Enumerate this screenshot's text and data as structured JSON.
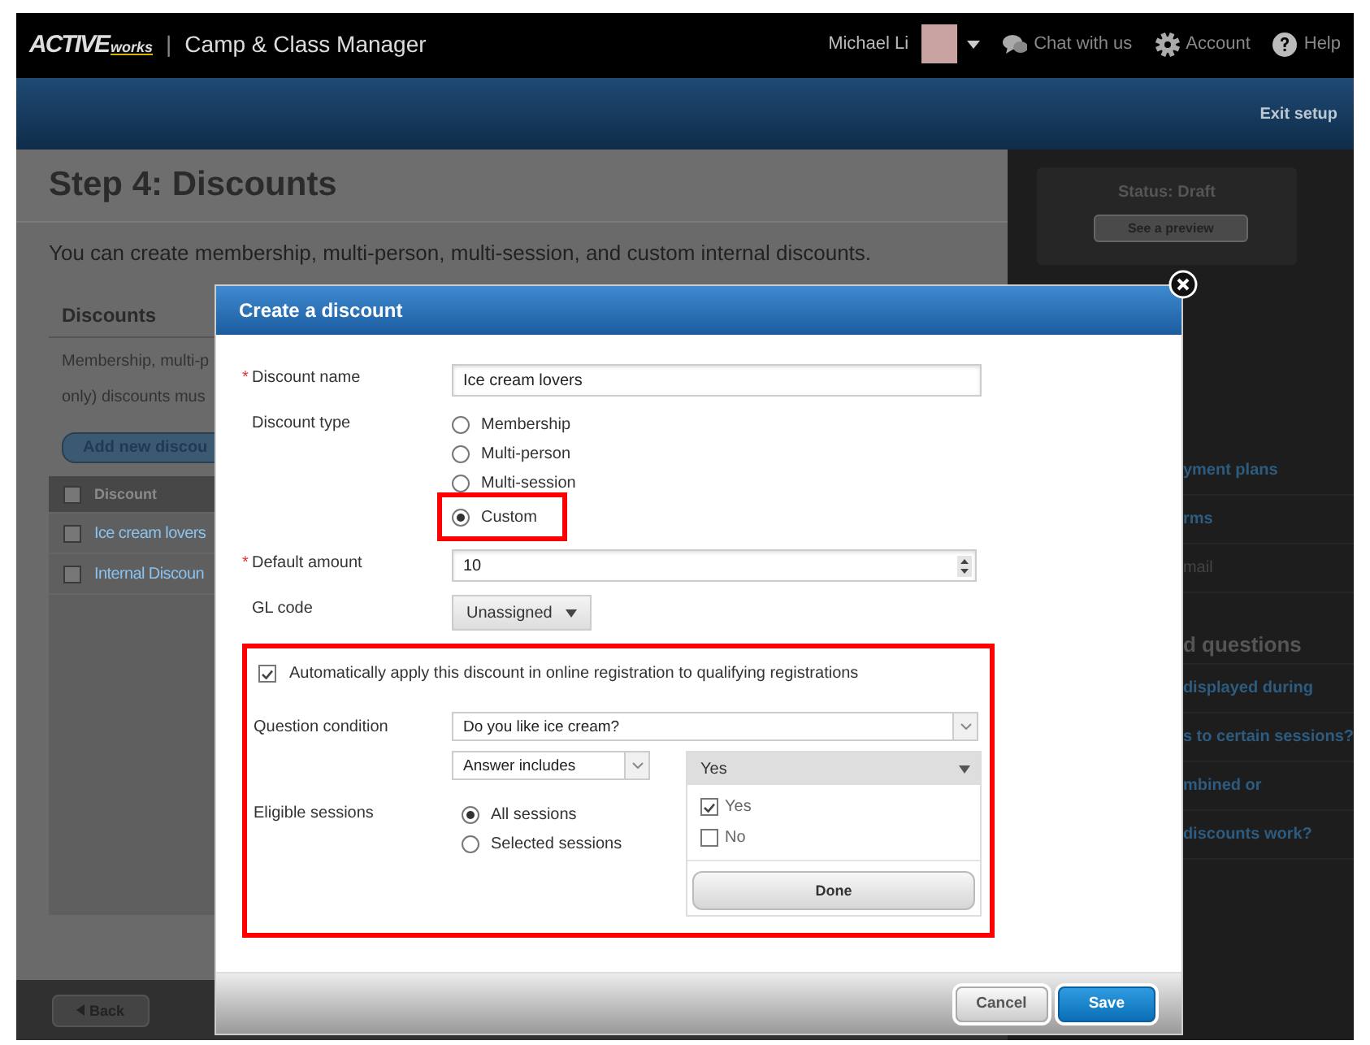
{
  "top_bar": {
    "logo": {
      "main": "ACTIVE",
      "sub": "works"
    },
    "separator": "|",
    "app_title": "Camp & Class Manager",
    "user_name": "Michael Li",
    "links": [
      {
        "kind": "chat",
        "label": "Chat with us"
      },
      {
        "kind": "account",
        "label": "Account"
      },
      {
        "kind": "help",
        "label": "Help"
      }
    ]
  },
  "setup_bar": {
    "exit_link": "Exit setup"
  },
  "page": {
    "title": "Step 4: Discounts",
    "intro": "You can create membership, multi-person, multi-session, and custom internal discounts.",
    "section_title": "Discounts",
    "section_text": [
      "Membership, multi-p",
      "only) discounts mus"
    ],
    "add_button": "Add new discou",
    "table": {
      "header": "Discount",
      "header_checked": false,
      "rows": [
        {
          "name": "Ice cream lovers",
          "checked": false
        },
        {
          "name": "Internal Discoun",
          "checked": false
        }
      ]
    },
    "back_button": "Back"
  },
  "sidebar": {
    "status": "Status: Draft",
    "preview_button": "See a preview",
    "items": [
      {
        "kind": "link",
        "text": "yment plans"
      },
      {
        "kind": "link",
        "text": "rms"
      },
      {
        "kind": "muted",
        "text": "mail"
      },
      {
        "kind": "heading",
        "text": "d questions"
      },
      {
        "kind": "link",
        "text": "displayed during"
      },
      {
        "kind": "link",
        "text": "s to certain sessions?"
      },
      {
        "kind": "link",
        "text": "mbined or"
      },
      {
        "kind": "link",
        "text": "discounts work?"
      }
    ]
  },
  "dialog": {
    "title": "Create a discount",
    "fields": [
      {
        "kind": "text",
        "label": "Discount name",
        "required_mark": "*",
        "value": "Ice cream lovers"
      },
      {
        "kind": "radio",
        "label": "Discount type",
        "options": [
          {
            "label": "Membership",
            "selected": false,
            "highlighted": false
          },
          {
            "label": "Multi-person",
            "selected": false,
            "highlighted": false
          },
          {
            "label": "Multi-session",
            "selected": false,
            "highlighted": false
          },
          {
            "label": "Custom",
            "selected": true,
            "highlighted": true
          }
        ]
      },
      {
        "kind": "number",
        "label": "Default amount",
        "required_mark": "*",
        "value": "10"
      },
      {
        "kind": "dropdown",
        "label": "GL code",
        "value": "Unassigned"
      }
    ],
    "auto_apply": {
      "highlighted": true,
      "checked": true,
      "label": "Automatically apply this discount in online registration to qualifying registrations",
      "question_label": "Question condition",
      "question_value": "Do you like ice cream?",
      "operator_value": "Answer includes",
      "eligible_label": "Eligible sessions",
      "session_options": [
        {
          "label": "All sessions",
          "selected": true
        },
        {
          "label": "Selected sessions",
          "selected": false
        }
      ],
      "answers": {
        "header": "Yes",
        "options": [
          {
            "label": "Yes",
            "checked": true
          },
          {
            "label": "No",
            "checked": false
          }
        ],
        "done_button": "Done"
      }
    },
    "buttons": [
      {
        "kind": "secondary",
        "label": "Cancel"
      },
      {
        "kind": "primary",
        "label": "Save"
      }
    ]
  }
}
